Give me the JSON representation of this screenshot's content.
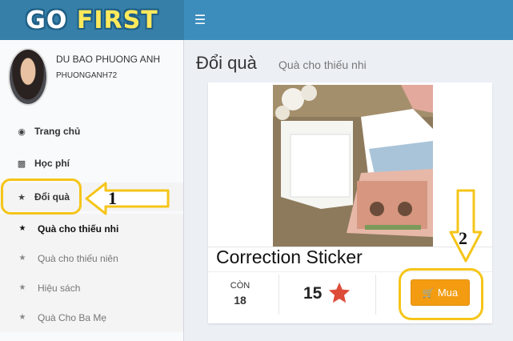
{
  "app": {
    "logo_parts": [
      "GO ",
      "FIRST"
    ],
    "menu_icon": "hamburger-icon"
  },
  "user": {
    "name": "DU BAO PHUONG ANH",
    "login": "PHUONGANH72"
  },
  "sidebar": {
    "items": [
      {
        "label": "Trang chủ",
        "icon": "dashboard-icon"
      },
      {
        "label": "Học phí",
        "icon": "briefcase-icon"
      },
      {
        "label": "Đổi quà",
        "icon": "star-icon",
        "active": true
      }
    ],
    "subitems": [
      {
        "label": "Quà cho thiếu nhi",
        "active": true
      },
      {
        "label": "Quà cho thiếu niên"
      },
      {
        "label": "Hiệu sách"
      },
      {
        "label": "Quà Cho Ba Mẹ"
      }
    ]
  },
  "page": {
    "title": "Đổi quà",
    "subtitle": "Quà cho thiếu nhi"
  },
  "product": {
    "name": "Correction Sticker",
    "stock_label": "CÒN",
    "stock_value": "18",
    "price": "15",
    "buy_label": "Mua"
  },
  "annotations": {
    "one": "1",
    "two": "2"
  },
  "colors": {
    "header": "#3c8dbc",
    "logo_bg": "#367fa9",
    "buy_button": "#f39c12",
    "star": "#dd4b39",
    "annotation": "#f5c518"
  }
}
